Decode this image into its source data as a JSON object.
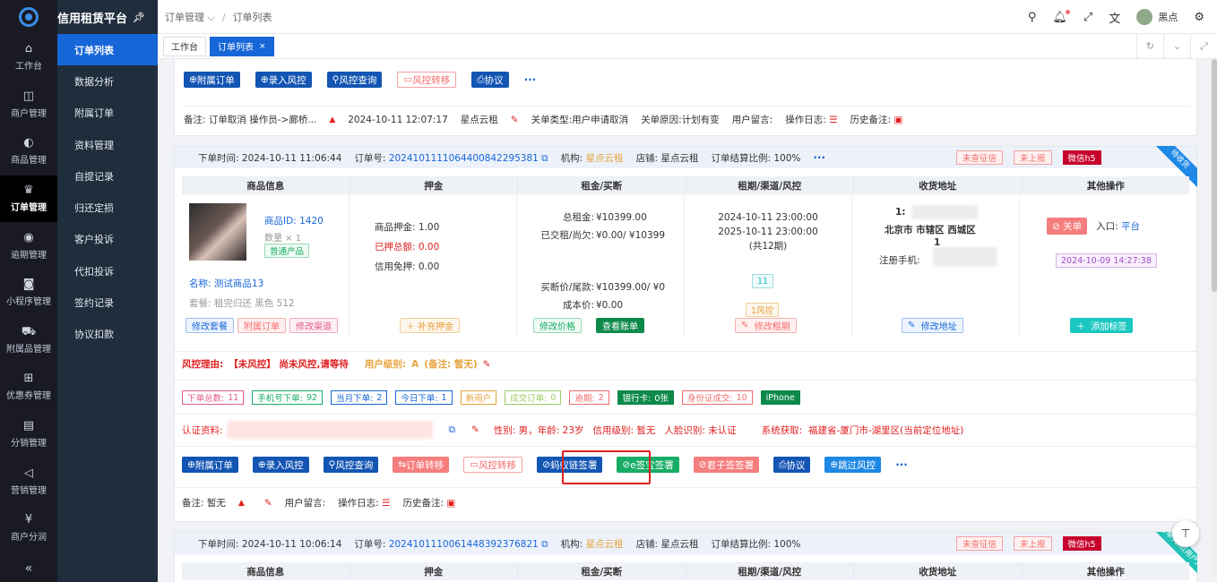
{
  "brand": {
    "title": "信用租赁平台"
  },
  "nav": [
    {
      "label": "工作台",
      "icon": "home-icon",
      "glyph": "⌂"
    },
    {
      "label": "商户管理",
      "icon": "shopping-bag-icon",
      "glyph": "◫"
    },
    {
      "label": "商品管理",
      "icon": "apple-icon",
      "glyph": "◐"
    },
    {
      "label": "订单管理",
      "icon": "trophy-icon",
      "glyph": "♛"
    },
    {
      "label": "逾期管理",
      "icon": "alarm-icon",
      "glyph": "◉"
    },
    {
      "label": "小程序管理",
      "icon": "watch-icon",
      "glyph": "◙"
    },
    {
      "label": "附属品管理",
      "icon": "cart-icon",
      "glyph": "⛟"
    },
    {
      "label": "优惠券管理",
      "icon": "gift-icon",
      "glyph": "⊞"
    },
    {
      "label": "分销管理",
      "icon": "data-board-icon",
      "glyph": "▤"
    },
    {
      "label": "营销管理",
      "icon": "megaphone-icon",
      "glyph": "◁"
    },
    {
      "label": "商户分润",
      "icon": "yen-icon",
      "glyph": "¥"
    }
  ],
  "submenu": [
    "订单列表",
    "数据分析",
    "附属订单",
    "资料管理",
    "自提记录",
    "归还定损",
    "客户投诉",
    "代扣投诉",
    "签约记录",
    "协议扣款"
  ],
  "breadcrumb": {
    "parent": "订单管理",
    "current": "订单列表"
  },
  "user": {
    "name": "黑点"
  },
  "tabs": [
    {
      "label": "工作台"
    },
    {
      "label": "订单列表",
      "close": "×"
    }
  ],
  "prev_card": {
    "buttons": [
      "附属订单",
      "录入风控",
      "风控查询",
      "风控转移",
      "协议"
    ],
    "remark_label": "备注:",
    "remark": "订单取消 操作员->廊桥...",
    "time": "2024-10-11 12:07:17",
    "shop": "星点云租",
    "close_type_label": "关单类型:",
    "close_type": "用户申请取消",
    "close_reason_label": "关单原因:",
    "close_reason": "计划有变",
    "user_msg": "用户留言:",
    "op_log": "操作日志:",
    "history": "历史备注:"
  },
  "order1": {
    "time_label": "下单时间:",
    "time": "2024-10-11 11:06:44",
    "no_label": "订单号:",
    "no": "20241011110644008422953​81",
    "org_label": "机构:",
    "org": "星点云租",
    "shop_label": "店铺:",
    "shop": "星点云租",
    "ratio_label": "订单结算比例:",
    "ratio": "100%",
    "tags": [
      "未查征信",
      "未上报"
    ],
    "channel": "微信h5",
    "corner": "待收货",
    "cols": [
      "商品信息",
      "押金",
      "租金/买断",
      "租期/渠道/风控",
      "收货地址",
      "其他操作"
    ],
    "product": {
      "id_label": "商品ID:",
      "id": "1420",
      "qty": "数量 × 1",
      "tag": "普通产品",
      "name_label": "名称:",
      "name": "测试商品13",
      "plan_label": "套餐:",
      "plan": "租完归还 黑色 512"
    },
    "deposit": {
      "l1": "商品押金:",
      "v1": "1.00",
      "l2": "已押总额:",
      "v2": "0.00",
      "l3": "信用免押:",
      "v3": "0.00"
    },
    "rent": {
      "l1": "总租金:",
      "v1": "¥10399.00",
      "l2": "已交租/尚欠:",
      "v2": "¥0.00/ ¥10399",
      "l3": "买断价/尾款:",
      "v3": "¥10399.00/ ¥0",
      "l4": "成本价:",
      "v4": "¥0.00"
    },
    "period": {
      "start": "2024-10-11 23:00:00",
      "end": "2025-10-11 23:00:00",
      "count": "(共12期)",
      "channel": "11",
      "risk": "1风控"
    },
    "address": {
      "name": "1:",
      "city": "北京市 市辖区 西城区",
      "line": "1",
      "phone_label": "注册手机:"
    },
    "other": {
      "close": "关单",
      "entry_label": "入口:",
      "entry": "平台",
      "date": "2024-10-09 14:27:38"
    },
    "cell_buttons": {
      "edit_plan": "修改套餐",
      "sub_order": "附属订单",
      "edit_channel": "修改渠道",
      "add_deposit": "补充押金",
      "edit_price": "修改价格",
      "view_bill": "查看账单",
      "edit_period": "修改租期",
      "edit_address": "修改地址",
      "add_tag": "添加标签"
    },
    "risk": {
      "label": "风控理由:",
      "reason": "【未风控】 尚未风控,请等待",
      "level_label": "用户级别:",
      "level": "A",
      "level_note": "(备注: 暂无)"
    },
    "stats": [
      {
        "label": "下单总数:",
        "val": "11",
        "color": "#e35b8e"
      },
      {
        "label": "手机号下单:",
        "val": "92",
        "color": "#17ad65"
      },
      {
        "label": "当月下单:",
        "val": "2",
        "color": "#1766d8"
      },
      {
        "label": "今日下单:",
        "val": "1",
        "color": "#1766d8"
      },
      {
        "label": "新用户",
        "val": "",
        "color": "#e6a23c"
      },
      {
        "label": "成交订单:",
        "val": "0",
        "color": "#9ccc65"
      },
      {
        "label": "逾期:",
        "val": "2",
        "color": "#f56c6c"
      },
      {
        "label": "银行卡:",
        "val": "0张",
        "color": "#0d8a4a",
        "solid": true
      },
      {
        "label": "身份证成交:",
        "val": "10",
        "color": "#f56c6c"
      },
      {
        "label": "iPhone",
        "val": "",
        "color": "#0d8a4a",
        "solid": true
      }
    ],
    "auth": {
      "label": "认证资料:",
      "gender_label": "性别:",
      "gender": "男",
      "age_label": "年龄:",
      "age": "23岁",
      "credit_label": "信用级别:",
      "credit": "暂无",
      "face_label": "人脸识别:",
      "face": "未认证",
      "sys_label": "系统获取:",
      "sys": "福建省-厦门市-湖里区(当前定位地址)"
    },
    "buttons": [
      "附属订单",
      "录入风控",
      "风控查询",
      "订单转移",
      "风控转移",
      "蚂蚁链签署",
      "e签宝签署",
      "君子签签署",
      "协议",
      "跳过风控"
    ],
    "remark": {
      "label": "备注:",
      "value": "暂无",
      "user_msg": "用户留言:",
      "op_log": "操作日志:",
      "history": "历史备注:"
    }
  },
  "order2": {
    "time_label": "下单时间:",
    "time": "2024-10-11 10:06:14",
    "no_label": "订单号:",
    "no": "20241011100614483923768​21",
    "org_label": "机构:",
    "org": "星点云租",
    "shop_label": "店铺:",
    "shop": "星点云租",
    "ratio_label": "订单结算比例:",
    "ratio": "100%",
    "tags": [
      "未查征信",
      "未上报"
    ],
    "channel": "微信h5",
    "corner": "订单关闭(用户)",
    "cols": [
      "商品信息",
      "押金",
      "租金/买断",
      "租期/渠道/风控",
      "收货地址",
      "其他操作"
    ]
  },
  "colors": {
    "primary": "#1766d8",
    "sidebar": "#191a23",
    "submenu": "#1f2d3d",
    "danger": "#e02020"
  }
}
